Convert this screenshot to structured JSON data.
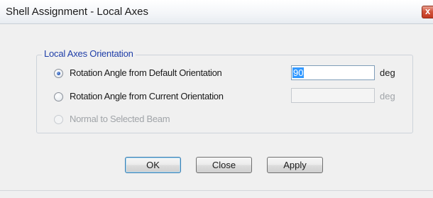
{
  "window": {
    "title": "Shell Assignment - Local Axes",
    "close_label": "x"
  },
  "group": {
    "legend": "Local Axes Orientation"
  },
  "options": [
    {
      "label": "Rotation Angle from Default Orientation",
      "checked": true,
      "enabled": true,
      "value": "90",
      "unit": "deg"
    },
    {
      "label": "Rotation Angle from Current Orientation",
      "checked": false,
      "enabled": true,
      "value": "",
      "unit": "deg"
    },
    {
      "label": "Normal to Selected Beam",
      "checked": false,
      "enabled": false
    }
  ],
  "buttons": {
    "ok": "OK",
    "close": "Close",
    "apply": "Apply"
  },
  "colors": {
    "accent": "#1f3ea8",
    "selection": "#3399ff",
    "disabled_text": "#a0a4a8"
  }
}
